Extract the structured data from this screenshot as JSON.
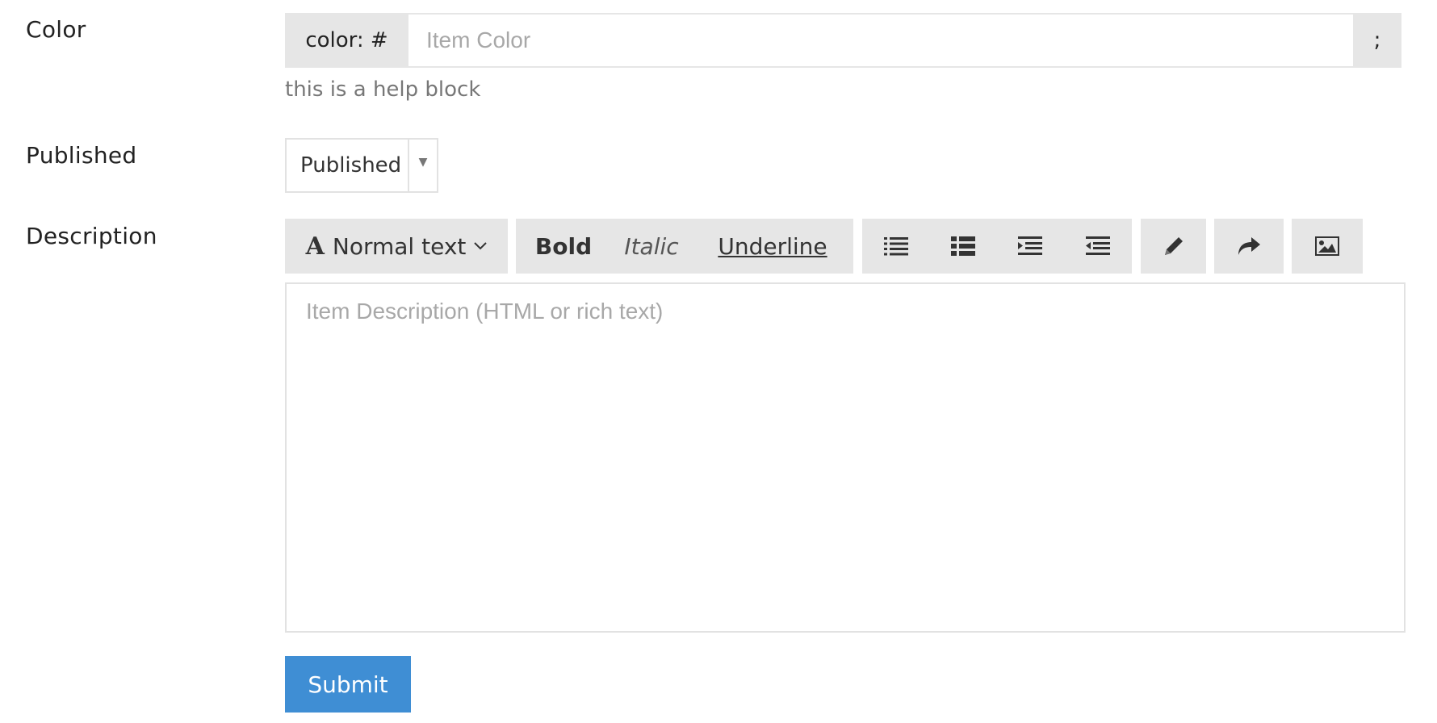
{
  "form": {
    "color": {
      "label": "Color",
      "prefix": "color: #",
      "placeholder": "Item Color",
      "value": "",
      "suffix": ";",
      "help": "this is a help block"
    },
    "published": {
      "label": "Published",
      "selected": "Published",
      "arrow_icon": "caret-down-icon"
    },
    "description": {
      "label": "Description",
      "placeholder": "Item Description (HTML or rich text)",
      "toolbar": {
        "font_style": "Normal text",
        "font_icon": "font-icon",
        "bold": "Bold",
        "italic": "Italic",
        "underline": "Underline",
        "list_icons": [
          "unordered-list-icon",
          "ordered-list-icon",
          "indent-icon",
          "outdent-icon"
        ],
        "pencil_icon": "pencil-icon",
        "redo_icon": "redo-icon",
        "image_icon": "image-icon"
      }
    },
    "submit_label": "Submit"
  },
  "colors": {
    "addon_bg": "#e6e6e6",
    "border": "#e2e2e2",
    "submit_bg": "#3f8ed4",
    "placeholder": "#a8a8a8",
    "help": "#777777"
  }
}
